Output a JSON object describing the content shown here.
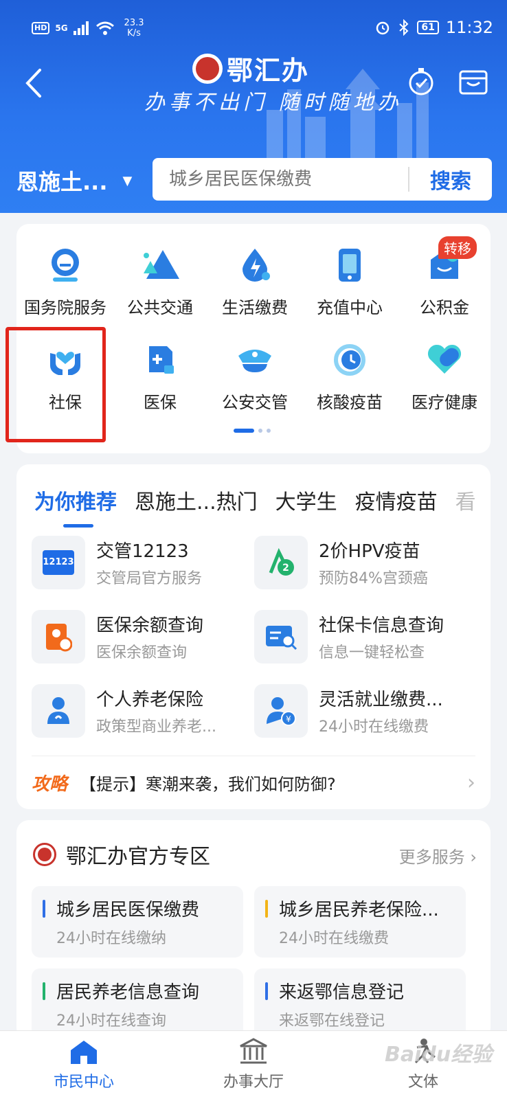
{
  "status_bar": {
    "hd": "HD",
    "signal": "5G",
    "net_speed_value": "23.3",
    "net_speed_unit": "K/s",
    "battery": "61",
    "time": "11:32"
  },
  "header": {
    "app_title": "鄂汇办",
    "slogan": "办事不出门 随时随地办",
    "region": "恩施土...",
    "search_placeholder": "城乡居民医保缴费",
    "search_button": "搜索"
  },
  "services": {
    "row1": [
      {
        "label": "国务院服务",
        "icon": "state-council-icon"
      },
      {
        "label": "公共交通",
        "icon": "public-transit-icon"
      },
      {
        "label": "生活缴费",
        "icon": "utility-payment-icon"
      },
      {
        "label": "充值中心",
        "icon": "recharge-phone-icon"
      },
      {
        "label": "公积金",
        "icon": "housing-fund-icon"
      }
    ],
    "row2": [
      {
        "label": "社保",
        "icon": "social-security-hands-heart-icon"
      },
      {
        "label": "医保",
        "icon": "medical-insurance-icon"
      },
      {
        "label": "公安交管",
        "icon": "police-cap-icon"
      },
      {
        "label": "核酸疫苗",
        "icon": "clock-refresh-icon"
      },
      {
        "label": "医疗健康",
        "icon": "health-capsule-icon"
      }
    ],
    "badge": "转移"
  },
  "recommend": {
    "tabs": [
      "为你推荐",
      "恩施土...热门",
      "大学生",
      "疫情疫苗",
      "看"
    ],
    "items": [
      {
        "title": "交管12123",
        "subtitle": "交管局官方服务",
        "icon": "traffic-12123-icon"
      },
      {
        "title": "2价HPV疫苗",
        "subtitle": "预防84%宫颈癌",
        "icon": "hpv-vaccine-icon"
      },
      {
        "title": "医保余额查询",
        "subtitle": "医保余额查询",
        "icon": "medical-balance-icon"
      },
      {
        "title": "社保卡信息查询",
        "subtitle": "信息一键轻松查",
        "icon": "card-search-icon"
      },
      {
        "title": "个人养老保险",
        "subtitle": "政策型商业养老...",
        "icon": "pension-person-icon"
      },
      {
        "title": "灵活就业缴费...",
        "subtitle": "24小时在线缴费",
        "icon": "employment-payment-icon"
      }
    ],
    "tip_tag": "攻略",
    "tip_text": "【提示】寒潮来袭，我们如何防御?"
  },
  "official": {
    "title": "鄂汇办官方专区",
    "more": "更多服务",
    "items": [
      {
        "title": "城乡居民医保缴费",
        "subtitle": "24小时在线缴纳",
        "bar_color": "#2f6fe6"
      },
      {
        "title": "城乡居民养老保险...",
        "subtitle": "24小时在线缴费",
        "bar_color": "#f2b418"
      },
      {
        "title": "居民养老信息查询",
        "subtitle": "24小时在线查询",
        "bar_color": "#23b26d"
      },
      {
        "title": "来返鄂信息登记",
        "subtitle": "来返鄂在线登记",
        "bar_color": "#2f6fe6"
      }
    ]
  },
  "bottom_nav": [
    {
      "label": "市民中心",
      "active": true
    },
    {
      "label": "办事大厅",
      "active": false
    },
    {
      "label": "文体",
      "active": false
    }
  ],
  "watermark": "Baidu经验",
  "colors": {
    "primary": "#1f6ce6",
    "highlight_red": "#e1251b",
    "tip_orange": "#f26a1b"
  }
}
